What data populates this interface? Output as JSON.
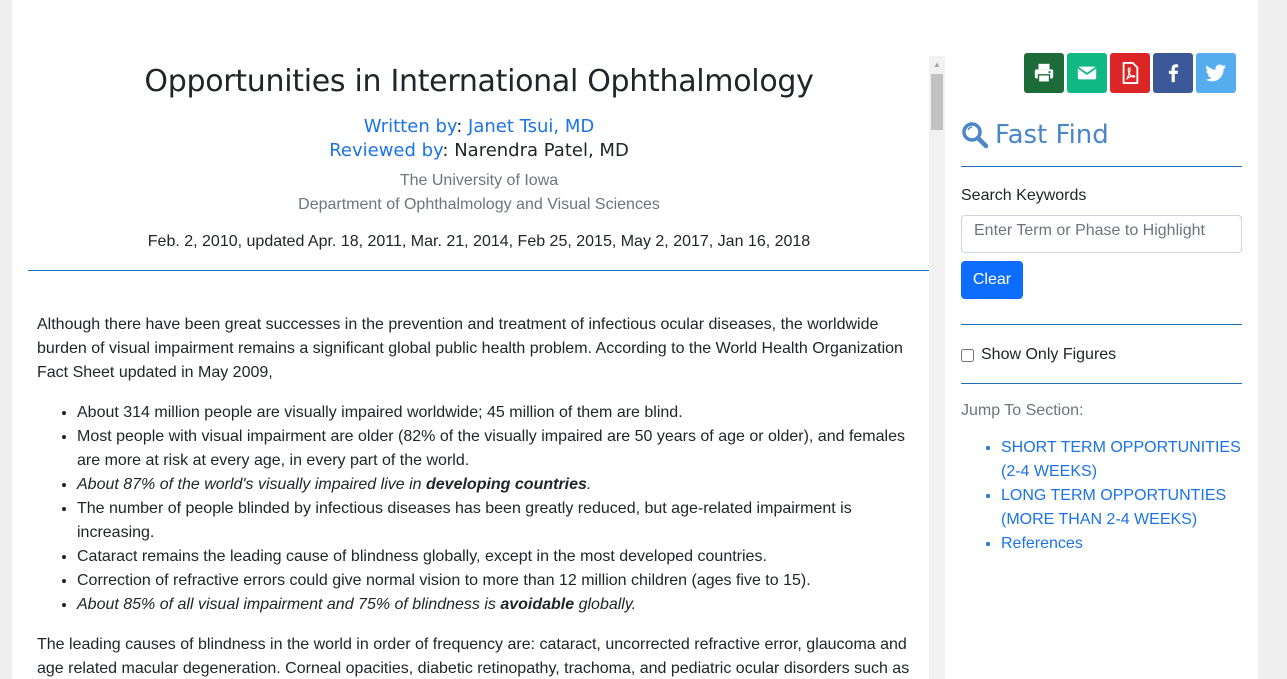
{
  "article": {
    "title": "Opportunities in International Ophthalmology",
    "written_label": "Written by",
    "written_name": "Janet Tsui, MD",
    "reviewed_label": "Reviewed by",
    "reviewed_name": "Narendra Patel, MD",
    "institution_1": "The University of Iowa",
    "institution_2": "Department of Ophthalmology and Visual Sciences",
    "dates": "Feb. 2, 2010, updated Apr. 18, 2011, Mar. 21, 2014, Feb 25, 2015, May 2, 2017, Jan 16, 2018",
    "intro": "Although there have been great successes in the prevention and treatment of infectious ocular diseases, the worldwide burden of visual impairment remains a significant global public health problem. According to the World Health Organization Fact Sheet updated in May 2009,",
    "bullets": [
      "About 314 million people are visually impaired worldwide; 45 million of them are blind.",
      "Most people with visual impairment are older (82% of the visually impaired are 50 years of age or older), and females are more at risk at every age, in every part of the world.",
      "About 87% of the world's visually impaired live in ",
      "The number of people blinded by infectious diseases has been greatly reduced, but age-related impairment is increasing.",
      "Cataract remains the leading cause of blindness globally, except in the most developed countries.",
      "Correction of refractive errors could give normal vision to more than 12 million children (ages five to 15).",
      "About 85% of all visual impairment and 75% of blindness is "
    ],
    "bullet3_bold": "developing countries",
    "bullet3_end": ".",
    "bullet7_bold": "avoidable",
    "bullet7_end": " globally.",
    "para2": "The leading causes of blindness in the world in order of frequency are: cataract, uncorrected refractive error, glaucoma and age related macular degeneration. Corneal opacities, diabetic retinopathy, trachoma, and pediatric ocular disorders such as"
  },
  "sidebar": {
    "fast_find": "Fast Find",
    "search_label": "Search Keywords",
    "search_placeholder": "Enter Term or Phase to Highlight",
    "clear_label": "Clear",
    "figures_label": "Show Only Figures",
    "jump_label": "Jump To Section:",
    "sections": [
      "SHORT TERM OPPORTUNITIES (2-4 WEEKS)",
      "LONG TERM OPPORTUNTIES (MORE THAN 2-4 WEEKS)",
      "References"
    ]
  },
  "share": [
    {
      "icon": "print-icon",
      "color": "#1e6b3a"
    },
    {
      "icon": "email-icon",
      "color": "#10b981"
    },
    {
      "icon": "pdf-icon",
      "color": "#dc2626"
    },
    {
      "icon": "facebook-icon",
      "color": "#3b5998"
    },
    {
      "icon": "twitter-icon",
      "color": "#55acee"
    }
  ],
  "colors": {
    "link": "#1a73e8",
    "accent_rule": "#1f6fb5",
    "fast_find": "#4a86c8",
    "button": "#0d6efd"
  }
}
